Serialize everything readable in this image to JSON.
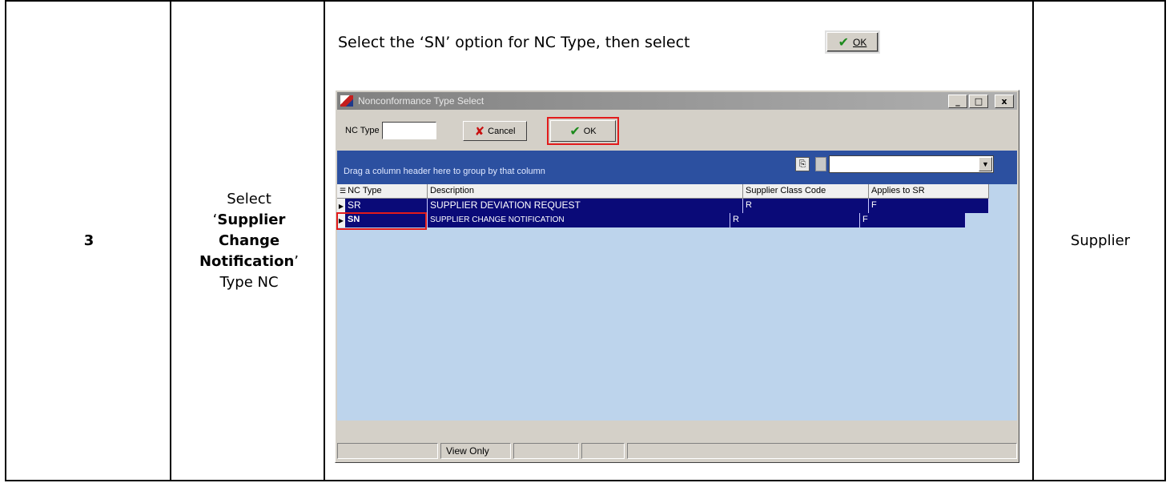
{
  "table": {
    "step_number": "3",
    "action": {
      "line1": "Select",
      "quote_open": "‘",
      "bold_line1": "Supplier",
      "bold_line2": "Change",
      "bold_line3": "Notification",
      "quote_close": "’",
      "line_last": "Type NC"
    },
    "responsible": "Supplier"
  },
  "instruction": {
    "text": "Select the ‘SN’ option for NC Type, then select",
    "ok_label": "OK"
  },
  "dialog": {
    "title": "Nonconformance Type Select",
    "window_buttons": {
      "minimize": "_",
      "maximize": "□",
      "close": "x"
    },
    "nc_type_label": "NC Type",
    "nc_type_value": "",
    "cancel_label": "Cancel",
    "ok_label": "OK",
    "group_bar_text": "Drag a column header here to group by that column",
    "combo_value": "",
    "columns": [
      "NC Type",
      "Description",
      "Supplier Class Code",
      "Applies to SR"
    ],
    "rows": [
      {
        "nc_type": "SR",
        "description": "SUPPLIER DEVIATION REQUEST",
        "class_code": "R",
        "applies_sr": "F"
      },
      {
        "nc_type": "SN",
        "description": "SUPPLIER CHANGE NOTIFICATION",
        "class_code": "R",
        "applies_sr": "F"
      }
    ],
    "status_bar": [
      "",
      "View Only",
      "",
      "",
      ""
    ]
  },
  "colors": {
    "highlight_red": "#e21b1b",
    "row_selected": "#0a0a78",
    "group_bar": "#2c50a0",
    "grid_bg": "#bdd4ec"
  }
}
